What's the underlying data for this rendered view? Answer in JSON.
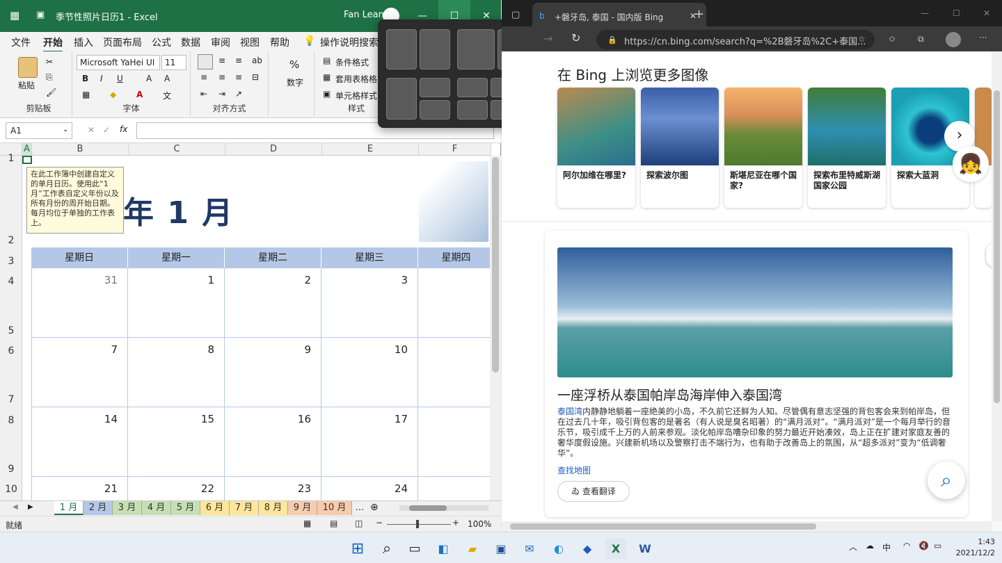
{
  "excel": {
    "title": "季节性照片日历1  -  Excel",
    "user": "Fan Lean",
    "menu_tabs": [
      "文件",
      "开始",
      "插入",
      "页面布局",
      "公式",
      "数据",
      "审阅",
      "视图",
      "帮助",
      "操作说明搜索"
    ],
    "ribbon": {
      "paste": "粘贴",
      "clipboard_group": "剪贴板",
      "font_name": "Microsoft YaHei UI",
      "font_size": "11",
      "font_group": "字体",
      "align_group": "对齐方式",
      "number_label": "数字",
      "cond_format": "条件格式",
      "table_format": "套用表格格式",
      "cell_style": "单元格样式",
      "styles_group": "样式"
    },
    "name_box": "A1",
    "fx_label": "fx",
    "columns": [
      "A",
      "B",
      "C",
      "D",
      "E",
      "F"
    ],
    "rows": [
      "1",
      "2",
      "3",
      "4",
      "5",
      "6",
      "7",
      "8",
      "9",
      "10"
    ],
    "month_title": "年 1 月",
    "tooltip": "在此工作簿中创建自定义的单月日历。使用此“1月”工作表自定义年份以及所有月份的周开始日期。每月均位于单独的工作表上。",
    "weekdays": [
      "星期日",
      "星期一",
      "星期二",
      "星期三",
      "星期四"
    ],
    "weeks": [
      [
        "31",
        "1",
        "2",
        "3",
        ""
      ],
      [
        "7",
        "8",
        "9",
        "10",
        ""
      ],
      [
        "14",
        "15",
        "16",
        "17",
        ""
      ],
      [
        "21",
        "22",
        "23",
        "24",
        ""
      ]
    ],
    "sheet_tabs": [
      "1 月",
      "2 月",
      "3 月",
      "4 月",
      "5 月",
      "6 月",
      "7 月",
      "8 月",
      "9 月",
      "10 月",
      "..."
    ],
    "status": "就绪",
    "zoom": "100%"
  },
  "edge": {
    "tab_title": "+磐牙岛, 泰国 - 国内版 Bing",
    "url": "https://cn.bing.com/search?q=%2B磐牙岛%2C+泰国...",
    "more_images_title": "在 Bing 上浏览更多图像",
    "cards": [
      {
        "caption": "阿尔加维在哪里?"
      },
      {
        "caption": "探索波尔图"
      },
      {
        "caption": "斯堪尼亚在哪个国家?"
      },
      {
        "caption": "探索布里特威斯湖国家公园"
      },
      {
        "caption": "探索大蓝洞"
      }
    ],
    "headline": "一座浮桥从泰国帕岸岛海岸伸入泰国湾",
    "para_link": "泰国湾",
    "paragraph": "内静静地躺着一座绝美的小岛，不久前它还鲜为人知。尽管偶有意志坚强的背包客会来到帕岸岛，但在过去几十年，吸引背包客的是著名（有人说是臭名昭著）的“满月派对”。“满月派对”是一个每月举行的音乐节，吸引成千上万的人前来参观。淡化帕岸岛嘈杂印象的努力最近开始凑效，岛上正在扩建对家庭友善的奢华度假设施。兴建新机场以及警察打击不端行为，也有助于改善岛上的氛围，从“超多派对”变为“低调奢华”。",
    "map_link": "查找地图",
    "translate": "查看翻译"
  },
  "taskbar": {
    "ime": "中",
    "time": "1:43",
    "date": "2021/12/2"
  }
}
